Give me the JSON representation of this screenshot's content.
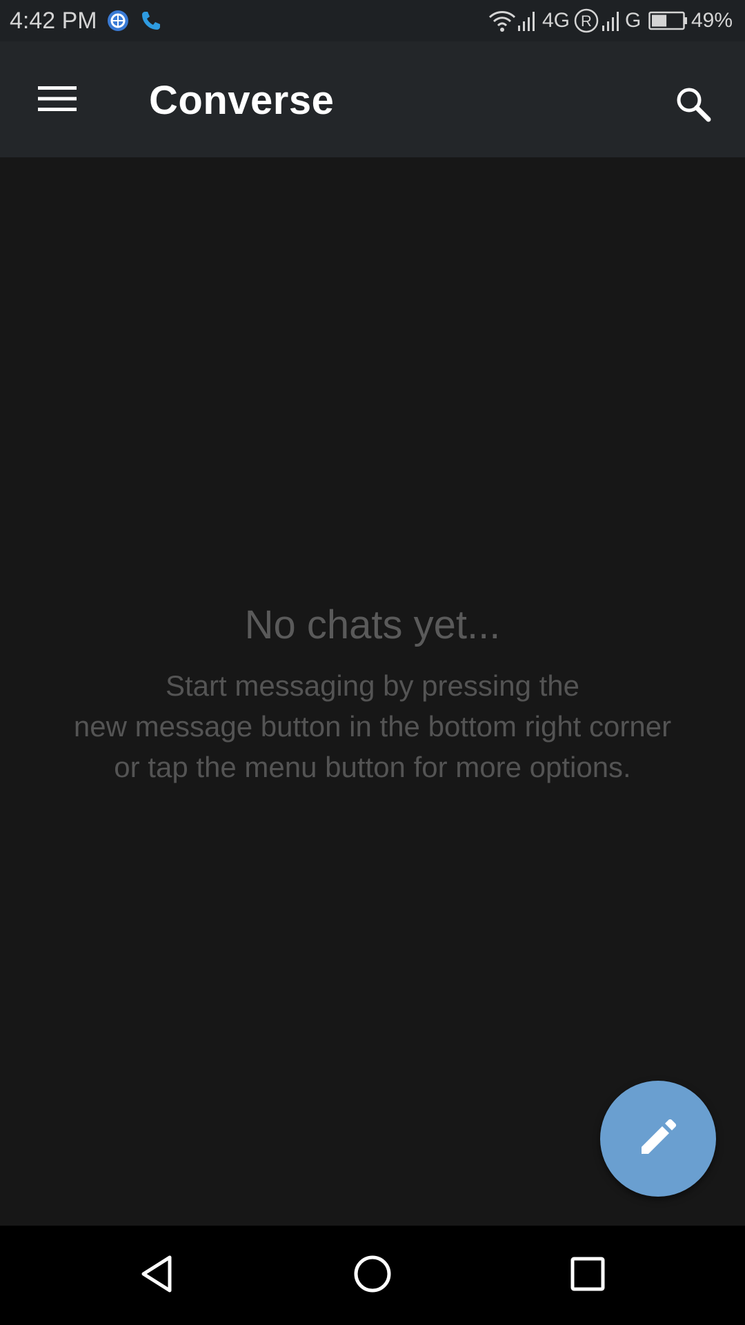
{
  "status_bar": {
    "time": "4:42 PM",
    "network_4g": "4G",
    "roaming": "R",
    "network_g": "G",
    "battery_percent": "49%",
    "battery_level": 0.49,
    "left_icons": [
      "browser-app-icon",
      "phone-call-icon"
    ],
    "right_icons": [
      "wifi-icon",
      "signal-icon",
      "roaming-icon",
      "signal-icon",
      "battery-icon"
    ]
  },
  "app_bar": {
    "title": "Converse",
    "menu_icon": "hamburger-menu-icon",
    "search_icon": "search-icon"
  },
  "empty_state": {
    "title": "No chats yet...",
    "description_lines": [
      "Start messaging by pressing the",
      "new message button in the bottom right corner",
      "or tap the menu button for more options."
    ]
  },
  "fab": {
    "icon": "pencil-icon",
    "color": "#6a9fd0"
  },
  "nav_bar": {
    "buttons": [
      "back-icon",
      "home-icon",
      "recents-icon"
    ]
  },
  "colors": {
    "background": "#171717",
    "app_bar": "#232629",
    "status_bar": "#1e2124",
    "title": "#ffffff",
    "empty_text": "#5a5a5a",
    "accent": "#6a9fd0"
  }
}
